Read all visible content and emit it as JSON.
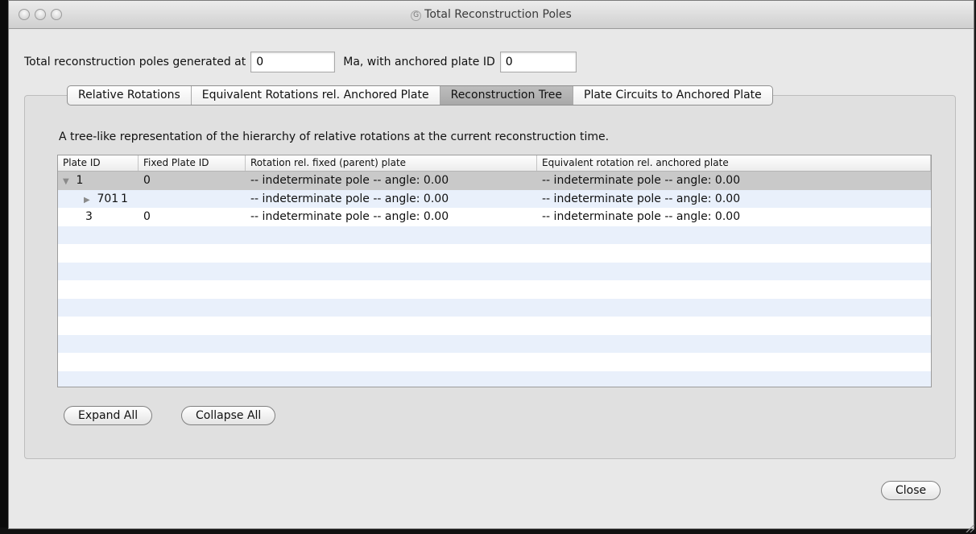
{
  "window": {
    "title": "Total Reconstruction Poles",
    "app_icon": "G"
  },
  "header": {
    "label_prefix": "Total reconstruction poles generated at",
    "time_value": "0",
    "label_middle": "Ma, with anchored plate ID",
    "anchor_value": "0"
  },
  "tabs": [
    {
      "label": "Relative Rotations",
      "selected": false
    },
    {
      "label": "Equivalent Rotations rel. Anchored Plate",
      "selected": false
    },
    {
      "label": "Reconstruction Tree",
      "selected": true
    },
    {
      "label": "Plate Circuits to Anchored Plate",
      "selected": false
    }
  ],
  "description": "A tree-like representation of the hierarchy of relative rotations at the current reconstruction time.",
  "table": {
    "columns": [
      "Plate ID",
      "Fixed Plate ID",
      "Rotation rel. fixed (parent) plate",
      "Equivalent rotation rel. anchored plate"
    ],
    "rows": [
      {
        "disclosure": "▼",
        "plate_id": "1",
        "fixed_plate_id": "0",
        "rotation": "-- indeterminate pole --   angle: 0.00",
        "equivalent": "-- indeterminate pole --   angle: 0.00"
      },
      {
        "disclosure": "▶",
        "plate_id": "701",
        "fixed_plate_id": "1",
        "rotation": "-- indeterminate pole --   angle: 0.00",
        "equivalent": "-- indeterminate pole --   angle: 0.00"
      },
      {
        "disclosure": "",
        "plate_id": "3",
        "fixed_plate_id": "0",
        "rotation": "-- indeterminate pole --   angle: 0.00",
        "equivalent": "-- indeterminate pole --   angle: 0.00"
      }
    ]
  },
  "buttons": {
    "expand_all": "Expand All",
    "collapse_all": "Collapse All",
    "close": "Close"
  }
}
